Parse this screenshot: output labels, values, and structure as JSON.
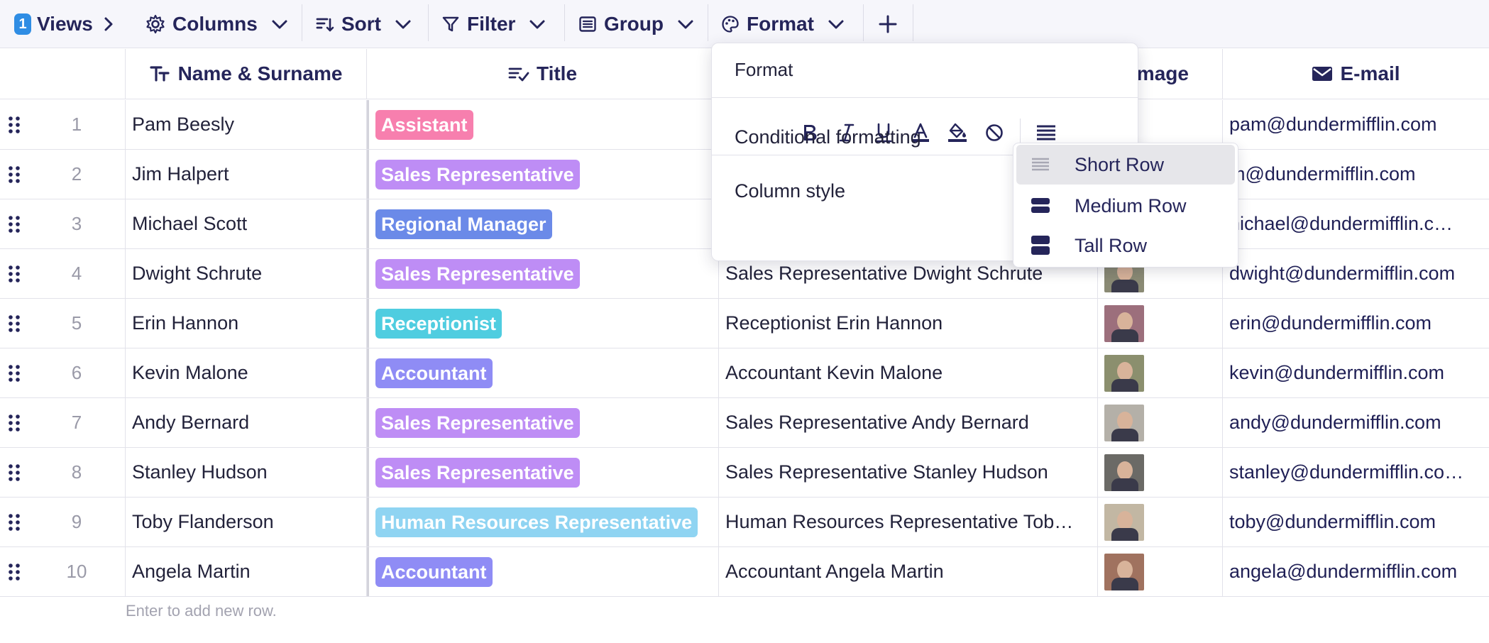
{
  "toolbar": {
    "views_count": "1",
    "views_label": "Views",
    "columns_label": "Columns",
    "sort_label": "Sort",
    "filter_label": "Filter",
    "group_label": "Group",
    "format_label": "Format",
    "add_label": "+"
  },
  "columns": {
    "name": "Name & Surname",
    "title": "Title",
    "image": "Image",
    "email": "E-mail"
  },
  "rows": [
    {
      "num": "1",
      "name": "Pam Beesly",
      "title": "Assistant",
      "title_color": "#f77fae",
      "full": "",
      "email": "pam@dundermifflin.com"
    },
    {
      "num": "2",
      "name": "Jim Halpert",
      "title": "Sales Representative",
      "title_color": "#be8df5",
      "full": "",
      "email": "m@dundermifflin.com"
    },
    {
      "num": "3",
      "name": "Michael Scott",
      "title": "Regional Manager",
      "title_color": "#6b8ae8",
      "full": "",
      "email": "nichael@dundermifflin.c…"
    },
    {
      "num": "4",
      "name": "Dwight Schrute",
      "title": "Sales Representative",
      "title_color": "#be8df5",
      "full": "Sales Representative Dwight Schrute",
      "email": "dwight@dundermifflin.com"
    },
    {
      "num": "5",
      "name": "Erin Hannon",
      "title": "Receptionist",
      "title_color": "#4fcde0",
      "full": "Receptionist Erin Hannon",
      "email": "erin@dundermifflin.com"
    },
    {
      "num": "6",
      "name": "Kevin Malone",
      "title": "Accountant",
      "title_color": "#8f8cf5",
      "full": "Accountant Kevin Malone",
      "email": "kevin@dundermifflin.com"
    },
    {
      "num": "7",
      "name": "Andy Bernard",
      "title": "Sales Representative",
      "title_color": "#be8df5",
      "full": "Sales Representative Andy Bernard",
      "email": "andy@dundermifflin.com"
    },
    {
      "num": "8",
      "name": "Stanley Hudson",
      "title": "Sales Representative",
      "title_color": "#be8df5",
      "full": "Sales Representative Stanley Hudson",
      "email": "stanley@dundermifflin.co…"
    },
    {
      "num": "9",
      "name": "Toby Flanderson",
      "title": "Human Resources Representative",
      "title_color": "#8fd4f2",
      "full": "Human Resources Representative Tob…",
      "email": "toby@dundermifflin.com"
    },
    {
      "num": "10",
      "name": "Angela Martin",
      "title": "Accountant",
      "title_color": "#8f8cf5",
      "full": "Accountant Angela Martin",
      "email": "angela@dundermifflin.com"
    }
  ],
  "add_row_hint": "Enter to add new row.",
  "format_popover": {
    "title": "Format",
    "conditional": "Conditional formatting",
    "column_style": "Column style"
  },
  "row_height_menu": {
    "short": "Short Row",
    "medium": "Medium Row",
    "tall": "Tall Row",
    "selected": "Short Row"
  },
  "colors": {
    "accent_dark": "#25255a",
    "badge_blue": "#2f8de4",
    "border": "#e2e2ea"
  }
}
